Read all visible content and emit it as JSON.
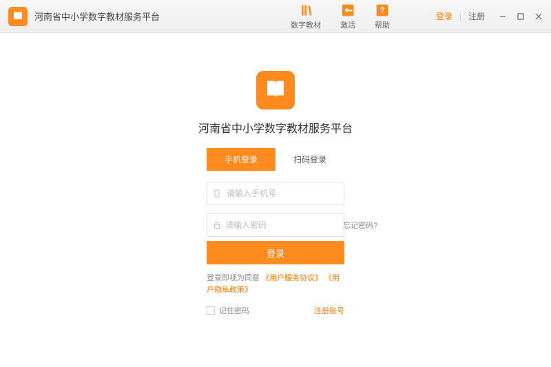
{
  "header": {
    "app_title": "河南省中小学数字教材服务平台",
    "nav": {
      "textbook": "数字教材",
      "activate": "激活",
      "help": "帮助"
    },
    "login_link": "登录",
    "register_link": "注册"
  },
  "login_panel": {
    "title": "河南省中小学数字教材服务平台",
    "tabs": {
      "phone": "手机登录",
      "qr": "扫码登录"
    },
    "phone_placeholder": "请输入手机号",
    "password_placeholder": "请输入密码",
    "forgot": "忘记密码?",
    "submit": "登录",
    "agreement": {
      "prefix": "登录即视为同意",
      "terms": "《用户服务协议》",
      "privacy": "《用户隐私政策》"
    },
    "remember": "记住密码",
    "register": "注册账号"
  }
}
